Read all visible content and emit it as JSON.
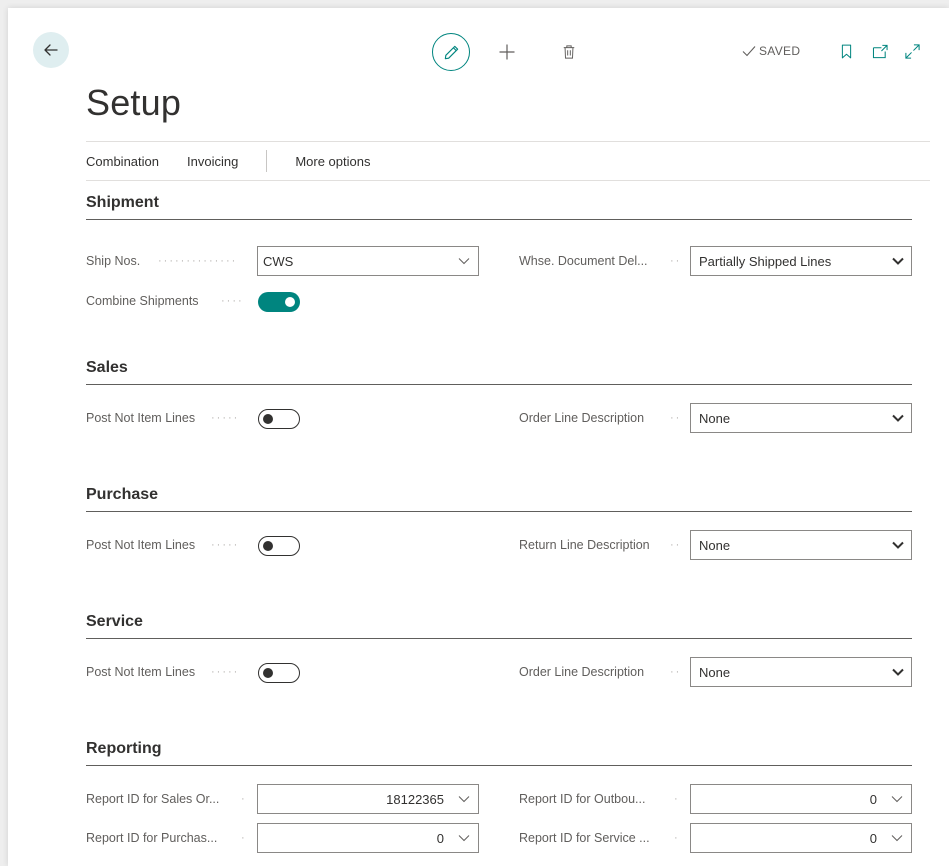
{
  "toolbar": {
    "saved_label": "SAVED"
  },
  "page": {
    "title": "Setup"
  },
  "actions": [
    {
      "label": "Combination"
    },
    {
      "label": "Invoicing"
    },
    {
      "label": "More options"
    }
  ],
  "shipment": {
    "title": "Shipment",
    "ship_nos_label": "Ship Nos.",
    "ship_nos_value": "CWS",
    "combine_label": "Combine Shipments",
    "combine_on": true,
    "whse_label": "Whse. Document Del...",
    "whse_value": "Partially Shipped Lines"
  },
  "sales": {
    "title": "Sales",
    "post_label": "Post Not Item Lines",
    "post_on": false,
    "desc_label": "Order Line Description",
    "desc_value": "None"
  },
  "purchase": {
    "title": "Purchase",
    "post_label": "Post Not Item Lines",
    "post_on": false,
    "desc_label": "Return Line Description",
    "desc_value": "None"
  },
  "service": {
    "title": "Service",
    "post_label": "Post Not Item Lines",
    "post_on": false,
    "desc_label": "Order Line Description",
    "desc_value": "None"
  },
  "reporting": {
    "title": "Reporting",
    "sales_order_label": "Report ID for Sales Or...",
    "sales_order_value": "18122365",
    "purchase_label": "Report ID for Purchas...",
    "purchase_value": "0",
    "outbound_label": "Report ID for Outbou...",
    "outbound_value": "0",
    "service_label": "Report ID for Service ...",
    "service_value": "0"
  },
  "colors": {
    "accent": "#00857f",
    "back_bg": "#dfeef0"
  }
}
